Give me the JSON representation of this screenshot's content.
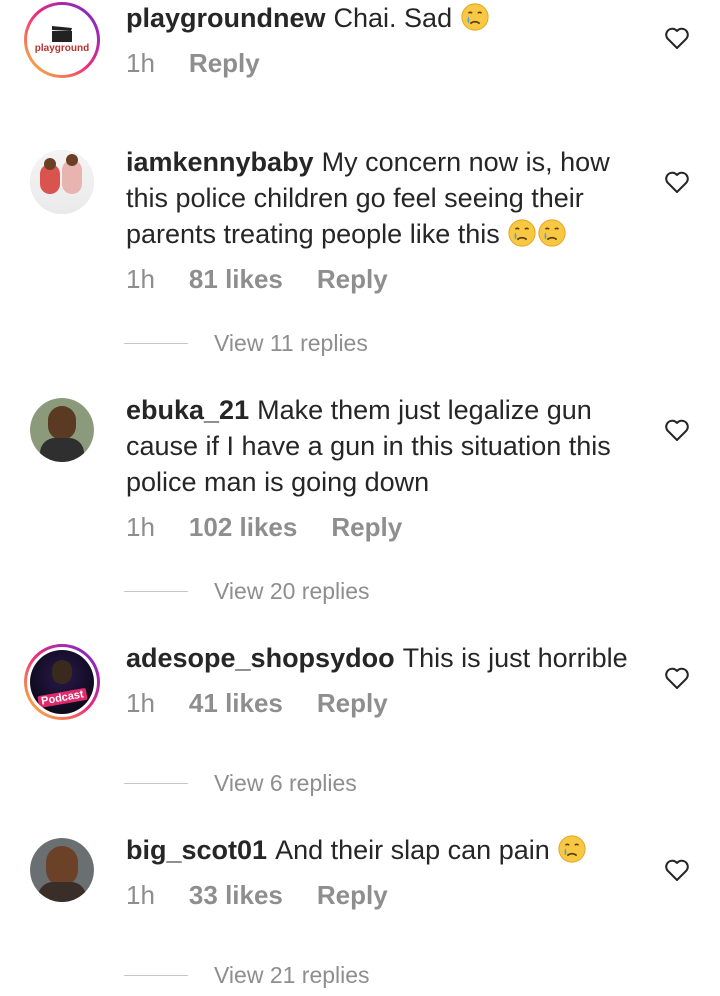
{
  "comments": [
    {
      "username": "playgroundnew",
      "text": "Chai. Sad",
      "time": "1h",
      "likes": "",
      "reply_label": "Reply",
      "emojis": [
        "crying-face"
      ],
      "view_replies": "",
      "avatar_text": "playground"
    },
    {
      "username": "iamkennybaby",
      "text": "My concern now is, how this police children go feel seeing their parents treating people like this",
      "time": "1h",
      "likes": "81 likes",
      "reply_label": "Reply",
      "emojis": [
        "crying-face",
        "crying-face"
      ],
      "view_replies": "View 11 replies"
    },
    {
      "username": "ebuka_21",
      "text": "Make them just legalize gun cause if I have a gun in this situation this police man is going down",
      "time": "1h",
      "likes": "102 likes",
      "reply_label": "Reply",
      "emojis": [],
      "view_replies": "View 20 replies"
    },
    {
      "username": "adesope_shopsydoo",
      "text": "This is just horrible",
      "time": "1h",
      "likes": "41 likes",
      "reply_label": "Reply",
      "emojis": [],
      "view_replies": "View 6 replies",
      "avatar_text": "Podcast"
    },
    {
      "username": "big_scot01",
      "text": "And their slap can pain",
      "time": "1h",
      "likes": "33 likes",
      "reply_label": "Reply",
      "emojis": [
        "crying-face"
      ],
      "view_replies": "View 21 replies"
    }
  ],
  "colors": {
    "text": "#262626",
    "muted": "#8e8e8e",
    "divider": "#c7c7c7"
  }
}
